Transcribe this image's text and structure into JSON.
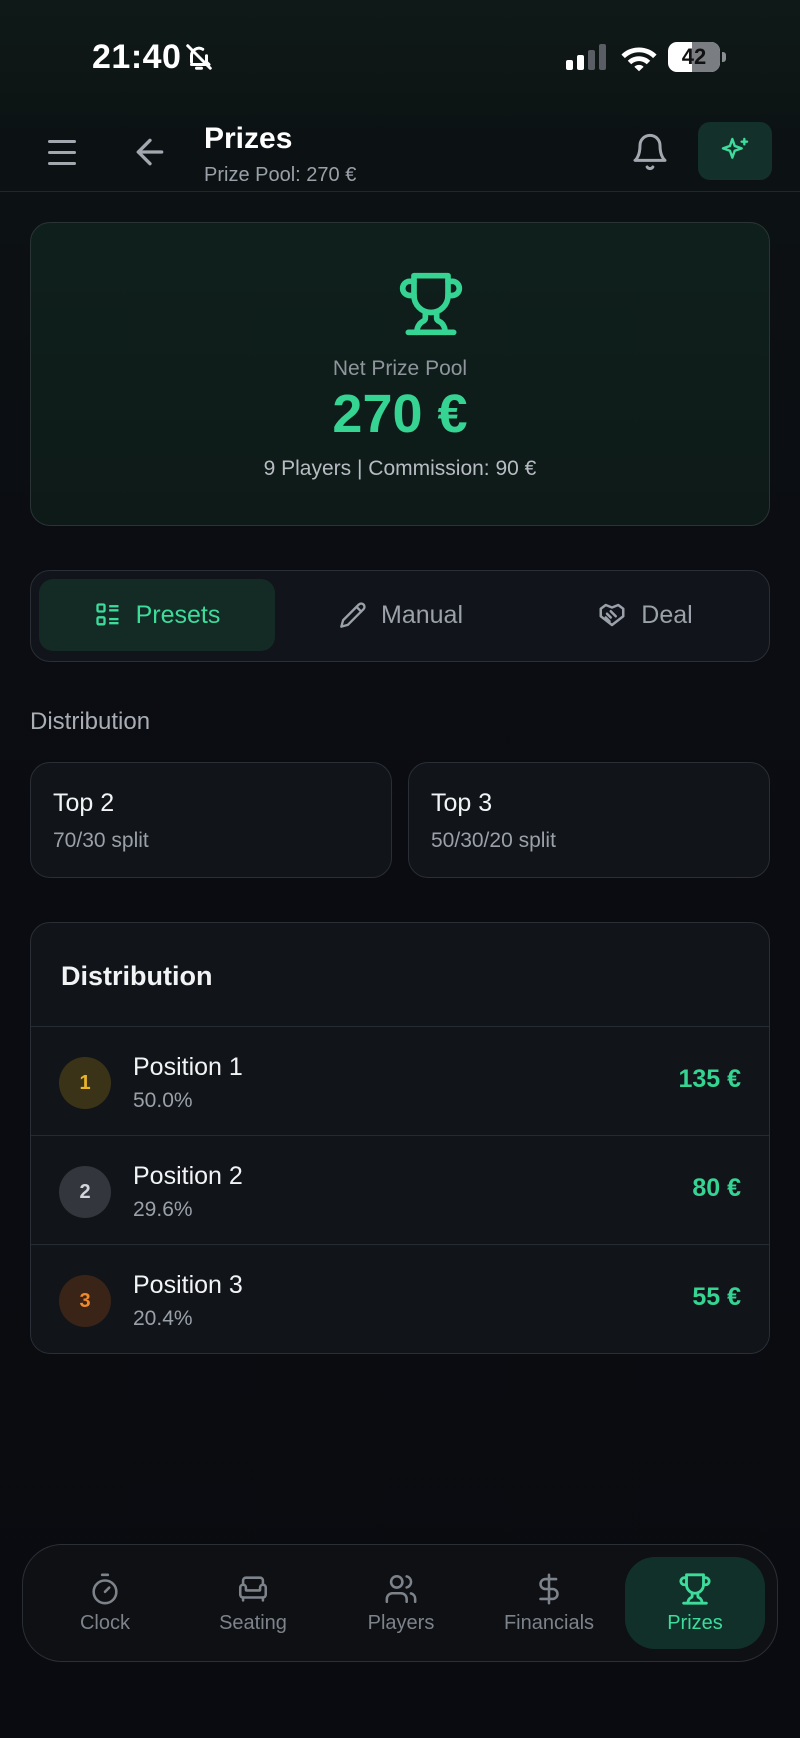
{
  "status_bar": {
    "time": "21:40",
    "battery": "42"
  },
  "header": {
    "title": "Prizes",
    "subtitle": "Prize Pool: 270 €"
  },
  "hero": {
    "label": "Net Prize Pool",
    "amount": "270 €",
    "meta": "9 Players | Commission: 90 €",
    "icon": "trophy-icon"
  },
  "tabs": [
    {
      "label": "Presets",
      "icon": "list-icon",
      "active": true
    },
    {
      "label": "Manual",
      "icon": "pencil-icon",
      "active": false
    },
    {
      "label": "Deal",
      "icon": "handshake-icon",
      "active": false
    }
  ],
  "presets": {
    "section_label": "Distribution",
    "items": [
      {
        "title": "Top 2",
        "subtitle": "70/30 split"
      },
      {
        "title": "Top 3",
        "subtitle": "50/30/20 split"
      }
    ]
  },
  "distribution": {
    "title": "Distribution",
    "rows": [
      {
        "rank": "1",
        "name": "Position 1",
        "percent": "50.0%",
        "amount": "135 €"
      },
      {
        "rank": "2",
        "name": "Position 2",
        "percent": "29.6%",
        "amount": "80 €"
      },
      {
        "rank": "3",
        "name": "Position 3",
        "percent": "20.4%",
        "amount": "55 €"
      }
    ]
  },
  "nav": [
    {
      "label": "Clock",
      "icon": "stopwatch-icon",
      "active": false
    },
    {
      "label": "Seating",
      "icon": "armchair-icon",
      "active": false
    },
    {
      "label": "Players",
      "icon": "users-icon",
      "active": false
    },
    {
      "label": "Financials",
      "icon": "dollar-icon",
      "active": false
    },
    {
      "label": "Prizes",
      "icon": "trophy-icon",
      "active": true
    }
  ],
  "colors": {
    "accent": "#35d492",
    "background": "#0a0b10",
    "gold": "#e7b42a",
    "silver": "#d3d6db",
    "bronze": "#f08a2a"
  }
}
